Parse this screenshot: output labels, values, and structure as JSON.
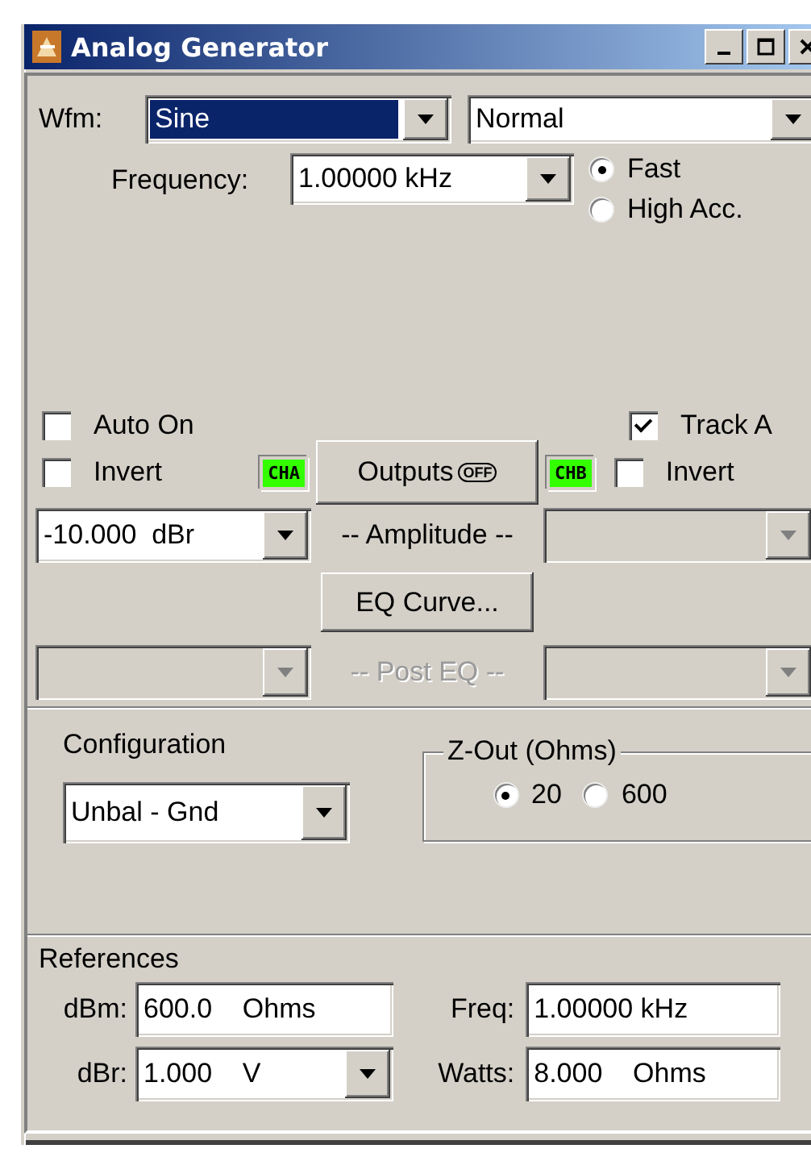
{
  "window": {
    "title": "Analog Generator"
  },
  "waveform": {
    "label": "Wfm:",
    "value": "Sine",
    "mode": "Normal"
  },
  "frequency": {
    "label": "Frequency:",
    "value": "1.00000 kHz",
    "options": [
      {
        "label": "Fast",
        "selected": true
      },
      {
        "label": "High Acc.",
        "selected": false
      }
    ]
  },
  "channel_a": {
    "auto_on": {
      "label": "Auto On",
      "checked": false
    },
    "invert": {
      "label": "Invert",
      "checked": false
    },
    "badge": "CHA",
    "amplitude": {
      "value": "-10.000  dBr",
      "disabled": false
    },
    "post_eq": {
      "disabled": true
    }
  },
  "channel_b": {
    "track_a": {
      "label": "Track A",
      "checked": true
    },
    "invert": {
      "label": "Invert",
      "checked": false
    },
    "badge": "CHB",
    "amplitude": {
      "disabled": true
    },
    "post_eq": {
      "disabled": true
    }
  },
  "outputs_button": {
    "label": "Outputs",
    "state": "OFF"
  },
  "amplitude_label": {
    "label": "-- Amplitude --",
    "disabled": false
  },
  "eq_button": {
    "label": "EQ Curve..."
  },
  "post_eq_label": {
    "label": "-- Post EQ --",
    "disabled": true
  },
  "configuration": {
    "label": "Configuration",
    "value": "Unbal - Gnd"
  },
  "z_out": {
    "title": "Z-Out (Ohms)",
    "options": [
      {
        "label": "20",
        "selected": true
      },
      {
        "label": "600",
        "selected": false
      }
    ]
  },
  "references": {
    "title": "References",
    "fields": [
      {
        "label": "dBm:",
        "value": "600.0    Ohms",
        "kind": "field"
      },
      {
        "label": "Freq:",
        "value": "1.00000 kHz",
        "kind": "field"
      },
      {
        "label": "dBr:",
        "value": "1.000    V",
        "kind": "combo"
      },
      {
        "label": "Watts:",
        "value": "8.000    Ohms",
        "kind": "field"
      }
    ]
  }
}
